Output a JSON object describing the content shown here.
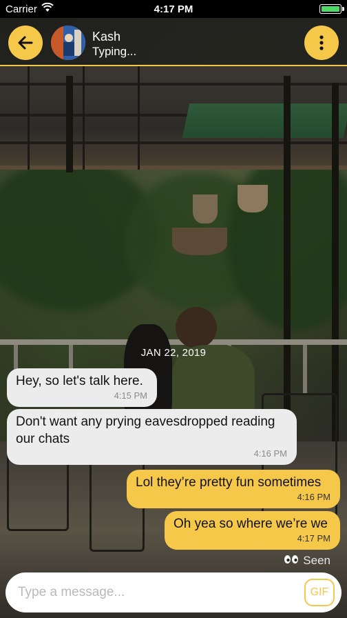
{
  "status_bar": {
    "carrier": "Carrier",
    "time": "4:17 PM",
    "battery_color": "#4cd964"
  },
  "header": {
    "back_icon": "arrow-left-icon",
    "contact_name": "Kash",
    "contact_status": "Typing...",
    "menu_icon": "more-vertical-icon",
    "accent_color": "#f5c84a"
  },
  "chat": {
    "date": "JAN 22, 2019",
    "messages": [
      {
        "direction": "incoming",
        "text": "Hey, so let's talk here.",
        "time": "4:15 PM"
      },
      {
        "direction": "incoming",
        "text": "Don't want any prying eavesdropped reading our chats",
        "time": "4:16 PM"
      },
      {
        "direction": "outgoing",
        "text": "Lol they’re pretty fun sometimes",
        "time": "4:16 PM"
      },
      {
        "direction": "outgoing",
        "text": "Oh yea so where we’re we",
        "time": "4:17 PM"
      }
    ],
    "seen_icon": "eyes-icon",
    "seen_label": "Seen"
  },
  "composer": {
    "placeholder": "Type a message...",
    "gif_label": "GIF"
  }
}
